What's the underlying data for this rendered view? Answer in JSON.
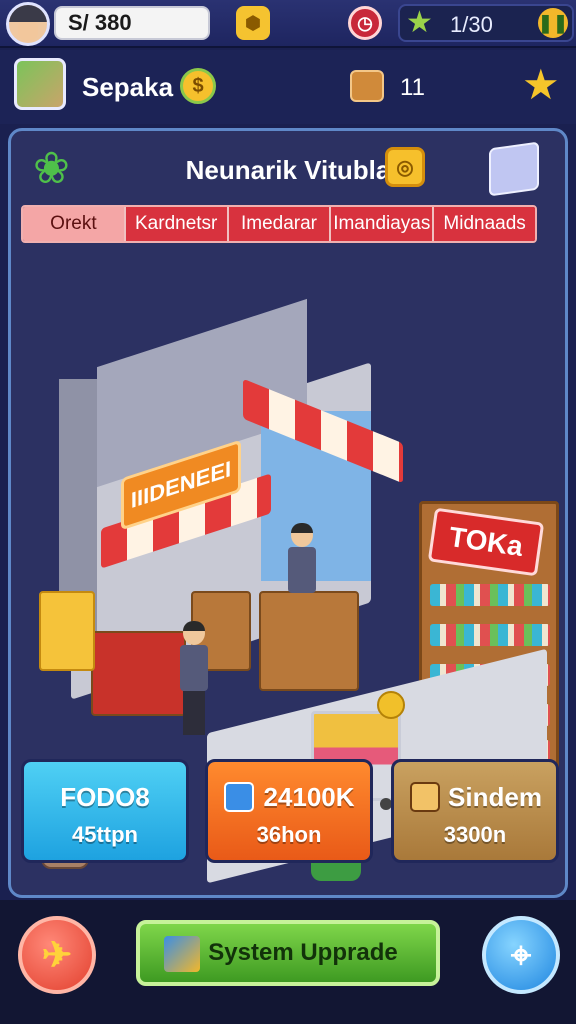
{
  "topbar": {
    "money": "S/ 380",
    "progress": "1/30",
    "icons": [
      "hexagon-coin-icon",
      "clock-icon",
      "star-icon",
      "pause-icon"
    ]
  },
  "store": {
    "name": "Sepaka",
    "count": "11"
  },
  "panel": {
    "title": "Neunarik Vitubla",
    "tabs": [
      "Orekt",
      "Kardnetsr",
      "Imedarar",
      "Imandiayas",
      "Midnaads"
    ],
    "active_tab": 0
  },
  "scene": {
    "sign_left": "IIIDENEEI",
    "sign_right": "TOKa"
  },
  "cards": [
    {
      "title": "FODO8",
      "subtitle": "45ttpn"
    },
    {
      "title": "24100K",
      "subtitle": "36hon"
    },
    {
      "title": "Sindem",
      "subtitle": "3300n"
    }
  ],
  "bottombar": {
    "upgrade_label": "System Upprade"
  },
  "colors": {
    "background": "#1a2050",
    "panel_border": "#5f88c8",
    "tab_red": "#d8323e",
    "upgrade_green": "#5fbf35"
  }
}
